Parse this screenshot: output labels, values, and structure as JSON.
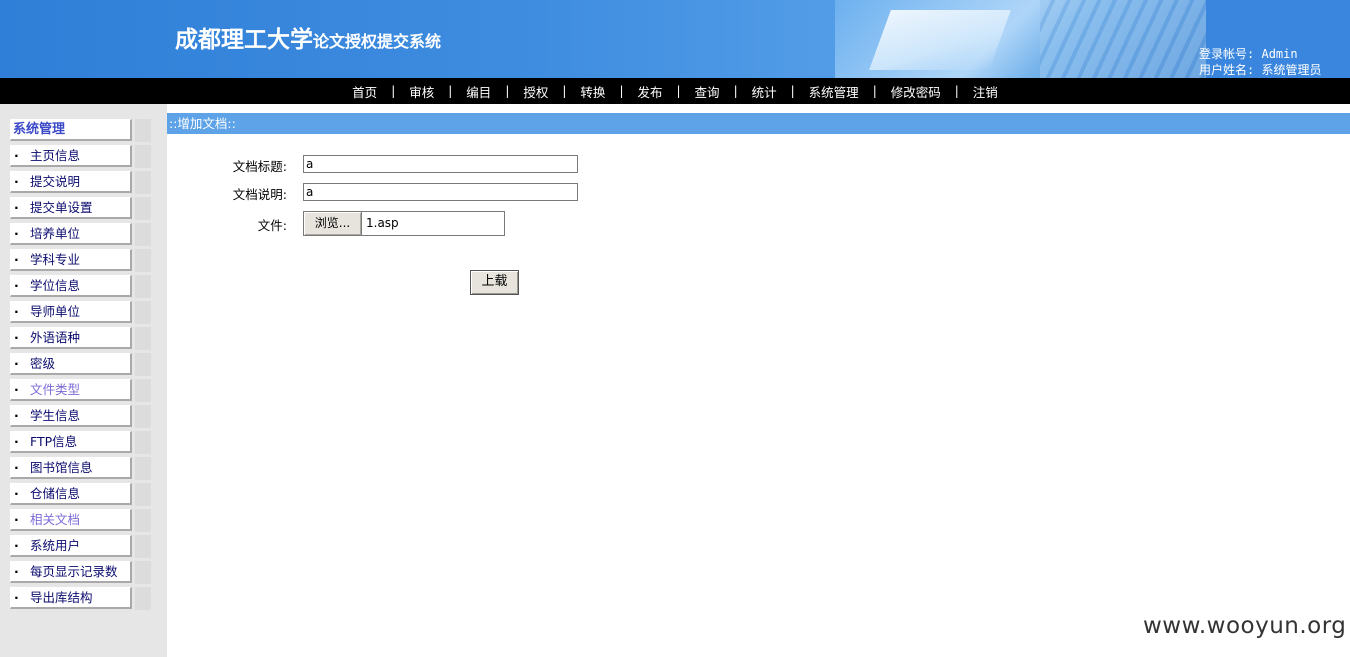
{
  "header": {
    "title_big": "成都理工大学",
    "title_small": "论文授权提交系统",
    "login_account_label": "登录帐号:",
    "login_account_value": "Admin",
    "user_name_label": "用户姓名:",
    "user_name_value": "系统管理员"
  },
  "nav": {
    "items": [
      "首页",
      "审核",
      "编目",
      "授权",
      "转换",
      "发布",
      "查询",
      "统计",
      "系统管理",
      "修改密码",
      "注销"
    ],
    "separator": "|"
  },
  "sidebar": {
    "heading": "系统管理",
    "bullet": "·",
    "items": [
      {
        "label": "主页信息",
        "visited": false
      },
      {
        "label": "提交说明",
        "visited": false
      },
      {
        "label": "提交单设置",
        "visited": false
      },
      {
        "label": "培养单位",
        "visited": false
      },
      {
        "label": "学科专业",
        "visited": false
      },
      {
        "label": "学位信息",
        "visited": false
      },
      {
        "label": "导师单位",
        "visited": false
      },
      {
        "label": "外语语种",
        "visited": false
      },
      {
        "label": "密级",
        "visited": false
      },
      {
        "label": "文件类型",
        "visited": true
      },
      {
        "label": "学生信息",
        "visited": false
      },
      {
        "label": "FTP信息",
        "visited": false
      },
      {
        "label": "图书馆信息",
        "visited": false
      },
      {
        "label": "仓储信息",
        "visited": false
      },
      {
        "label": "相关文档",
        "visited": true
      },
      {
        "label": "系统用户",
        "visited": false
      },
      {
        "label": "每页显示记录数",
        "visited": false
      },
      {
        "label": "导出库结构",
        "visited": false
      }
    ]
  },
  "main": {
    "section_title": "::增加文档::",
    "form": {
      "doc_title_label": "文档标题:",
      "doc_title_value": "a",
      "doc_desc_label": "文档说明:",
      "doc_desc_value": "a",
      "file_label": "文件:",
      "browse_label": "浏览...",
      "file_value": "1.asp",
      "upload_label": "上载"
    }
  },
  "watermark": "www.wooyun.org"
}
